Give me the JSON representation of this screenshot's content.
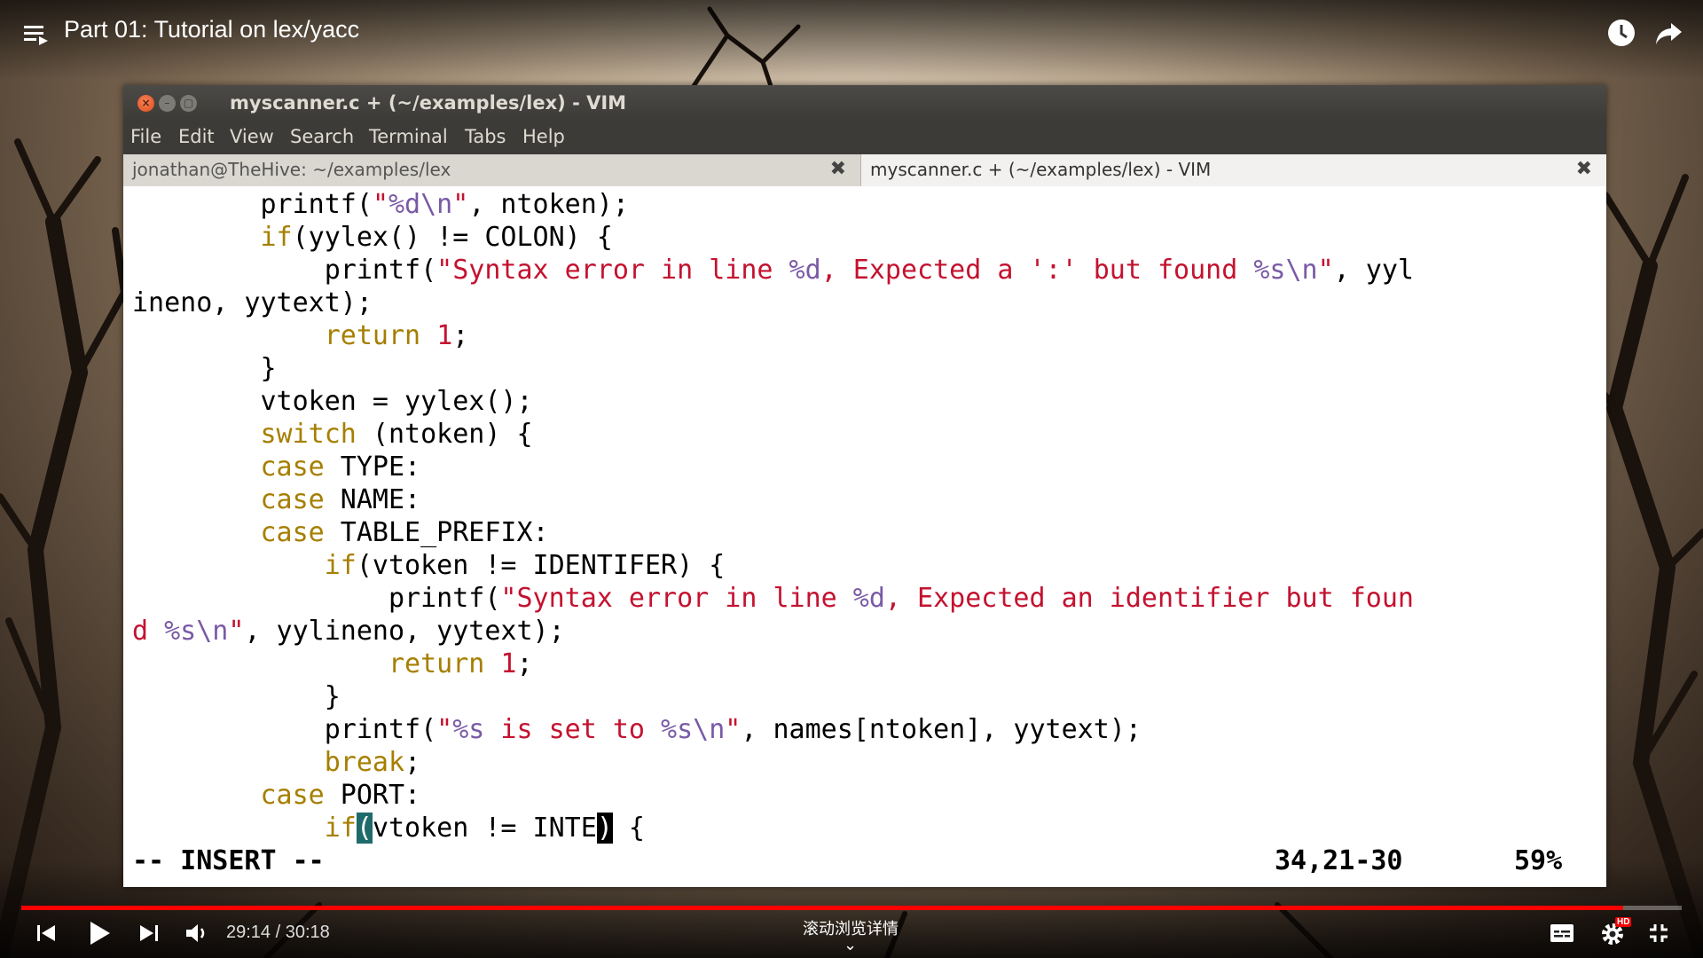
{
  "player": {
    "video_title": "Part 01: Tutorial on lex/yacc",
    "time_text": "29:14 / 30:18",
    "progress": 0.9648,
    "scroll_hint": "滚动浏览详情",
    "hd_badge": "HD"
  },
  "vim": {
    "window_title": "myscanner.c + (~/examples/lex) - VIM",
    "menu": [
      "File",
      "Edit",
      "View",
      "Search",
      "Terminal",
      "Tabs",
      "Help"
    ],
    "tabs": [
      {
        "label": "jonathan@TheHive: ~/examples/lex",
        "active": false
      },
      {
        "label": "myscanner.c + (~/examples/lex) - VIM",
        "active": true
      }
    ],
    "mode": "-- INSERT --",
    "position": "34,21-30",
    "percent": "59%"
  },
  "icons": {
    "menu": "playlist-menu-icon",
    "clock": "watch-later-icon",
    "share": "share-icon",
    "prev": "previous-icon",
    "play": "play-icon",
    "next": "next-icon",
    "volume": "volume-icon",
    "captions": "subtitles-icon",
    "settings": "gear-icon",
    "exit_fullscreen": "exit-fullscreen-icon"
  },
  "colors": {
    "keyword": "#a67f00",
    "string": "#c4122f",
    "format": "#7a5aa6",
    "progress": "#ff0000"
  }
}
